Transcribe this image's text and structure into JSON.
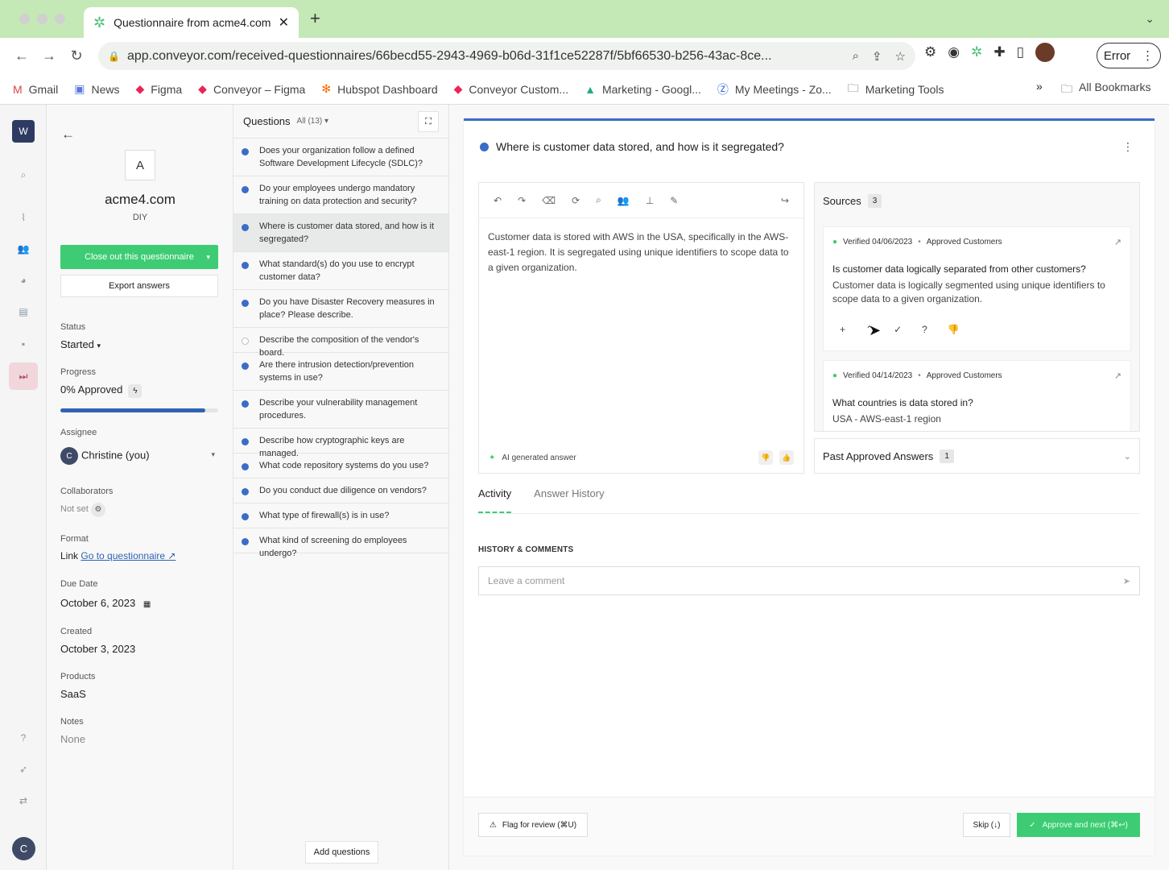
{
  "browser": {
    "tab_title": "Questionnaire from acme4.com",
    "url": "app.conveyor.com/received-questionnaires/66becd55-2943-4969-b06d-31f1ce52287f/5bf66530-b256-43ac-8ce...",
    "error_label": "Error",
    "bookmarks": [
      "Gmail",
      "News",
      "Figma",
      "Conveyor – Figma",
      "Hubspot Dashboard",
      "Conveyor Custom...",
      "Marketing - Googl...",
      "My Meetings - Zo...",
      "Marketing Tools"
    ],
    "bookmarks_more": "»",
    "all_bookmarks": "All Bookmarks"
  },
  "rail": {
    "logo": "W",
    "avatar": "C"
  },
  "sidebar": {
    "avatar_letter": "A",
    "company": "acme4.com",
    "type": "DIY",
    "close_label": "Close out this questionnaire",
    "export_label": "Export answers",
    "status_label": "Status",
    "status_value": "Started",
    "progress_label": "Progress",
    "progress_value": "0% Approved",
    "progress_fraction": 0.92,
    "assignee_label": "Assignee",
    "assignee_initial": "C",
    "assignee_value": "Christine (you)",
    "collaborators_label": "Collaborators",
    "collaborators_value": "Not set",
    "format_label": "Format",
    "format_value": "Link",
    "format_link": "Go to questionnaire ↗",
    "due_label": "Due Date",
    "due_value": "October 6, 2023",
    "created_label": "Created",
    "created_value": "October 3, 2023",
    "products_label": "Products",
    "products_value": "SaaS",
    "notes_label": "Notes",
    "notes_value": "None"
  },
  "questions": {
    "title": "Questions",
    "filter": "All (13)",
    "items": [
      {
        "text": "Does your organization follow a defined Software Development Lifecycle (SDLC)?"
      },
      {
        "text": "Do your employees undergo mandatory training on data protection and security?"
      },
      {
        "text": "Where is customer data stored, and how is it segregated?"
      },
      {
        "text": "What standard(s) do you use to encrypt customer data?"
      },
      {
        "text": "Do you have Disaster Recovery measures in place? Please describe."
      },
      {
        "text": "Describe the composition of the vendor's board."
      },
      {
        "text": "Are there intrusion detection/prevention systems in use?"
      },
      {
        "text": "Describe your vulnerability management procedures."
      },
      {
        "text": "Describe how cryptographic keys are managed."
      },
      {
        "text": "What code repository systems do you use?"
      },
      {
        "text": "Do you conduct due diligence on vendors?"
      },
      {
        "text": "What type of firewall(s) is in use?"
      },
      {
        "text": "What kind of screening do employees undergo?"
      }
    ],
    "add_label": "Add questions"
  },
  "main": {
    "question": "Where is customer data stored, and how is it segregated?",
    "answer": "Customer data is stored with AWS in the USA, specifically in the AWS-east-1 region. It is segregated using unique identifiers to scope data to a given organization.",
    "ai_label": "AI generated answer",
    "sources_label": "Sources",
    "sources_count": "3",
    "sources": [
      {
        "verified": "Verified 04/06/2023",
        "group": "Approved Customers",
        "question": "Is customer data logically separated from other customers?",
        "answer": "Customer data is logically segmented using unique identifiers to scope data to a given organization."
      },
      {
        "verified": "Verified 04/14/2023",
        "group": "Approved Customers",
        "question": "What countries is data stored in?",
        "answer": "USA - AWS-east-1 region"
      }
    ],
    "past_label": "Past Approved Answers",
    "past_count": "1",
    "tab_activity": "Activity",
    "tab_history": "Answer History",
    "history_heading": "HISTORY & COMMENTS",
    "comment_placeholder": "Leave a comment",
    "flag_label": "Flag for review (⌘U)",
    "skip_label": "Skip (↓)",
    "approve_label": "Approve and next (⌘↩)"
  }
}
